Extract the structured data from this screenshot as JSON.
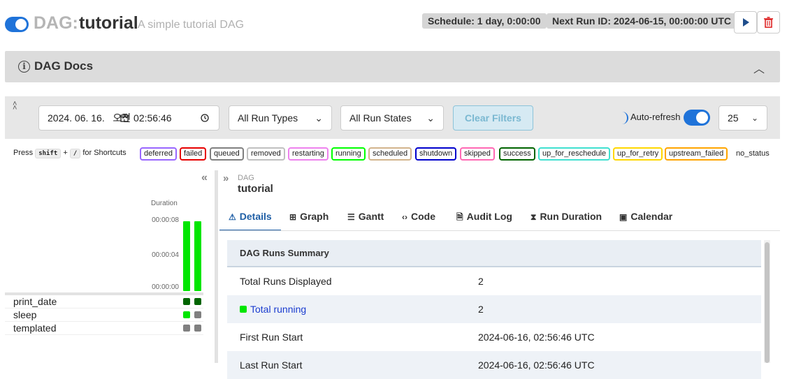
{
  "header": {
    "title_prefix": "DAG:",
    "dag_id": "tutorial",
    "description": "A simple tutorial DAG",
    "schedule": "Schedule: 1 day, 0:00:00",
    "next_run": "Next Run ID: 2024-06-15, 00:00:00 UTC"
  },
  "docs": {
    "label": "DAG Docs"
  },
  "filters": {
    "datetime": "2024. 06. 16.   오전 02:56:46",
    "run_type": "All Run Types",
    "run_state": "All Run States",
    "clear_label": "Clear Filters",
    "auto_refresh_label": "Auto-refresh",
    "page_size": "25"
  },
  "shortcuts": {
    "press": "Press",
    "key1": "shift",
    "plus": "+",
    "key2": "/",
    "suffix": "for Shortcuts"
  },
  "states": [
    {
      "label": "deferred",
      "color": "#9966ff"
    },
    {
      "label": "failed",
      "color": "#e60000"
    },
    {
      "label": "queued",
      "color": "#808080"
    },
    {
      "label": "removed",
      "color": "#c0c0c0"
    },
    {
      "label": "restarting",
      "color": "#ee82ee"
    },
    {
      "label": "running",
      "color": "#00ff00"
    },
    {
      "label": "scheduled",
      "color": "#d2b48c"
    },
    {
      "label": "shutdown",
      "color": "#0000cc"
    },
    {
      "label": "skipped",
      "color": "#ff69b4"
    },
    {
      "label": "success",
      "color": "#006400"
    },
    {
      "label": "up_for_reschedule",
      "color": "#40e0d0"
    },
    {
      "label": "up_for_retry",
      "color": "#ffd700"
    },
    {
      "label": "upstream_failed",
      "color": "#ffa500"
    },
    {
      "label": "no_status",
      "color": ""
    }
  ],
  "grid": {
    "duration_label": "Duration",
    "ticks": [
      "00:00:08",
      "00:00:04",
      "00:00:00"
    ],
    "run_bar_fill": [
      1.0,
      1.0
    ],
    "tasks": [
      {
        "name": "print_date",
        "states": [
          "success",
          "success"
        ]
      },
      {
        "name": "sleep",
        "states": [
          "running",
          "queued"
        ]
      },
      {
        "name": "templated",
        "states": [
          "queued",
          "queued"
        ]
      }
    ]
  },
  "breadcrumb": {
    "small": "DAG",
    "big": "tutorial"
  },
  "tabs": [
    {
      "label": "Details",
      "icon": "warning-icon",
      "glyph": "⚠"
    },
    {
      "label": "Graph",
      "icon": "graph-icon",
      "glyph": "⊞"
    },
    {
      "label": "Gantt",
      "icon": "gantt-icon",
      "glyph": "☰"
    },
    {
      "label": "Code",
      "icon": "code-icon",
      "glyph": "‹›"
    },
    {
      "label": "Audit Log",
      "icon": "audit-log-icon",
      "glyph": "🗎"
    },
    {
      "label": "Run Duration",
      "icon": "hourglass-icon",
      "glyph": "⧗"
    },
    {
      "label": "Calendar",
      "icon": "calendar-icon",
      "glyph": "▣"
    }
  ],
  "summary": {
    "title": "DAG Runs Summary",
    "rows": [
      {
        "key": "Total Runs Displayed",
        "value": "2"
      },
      {
        "key": "Total running",
        "value": "2"
      },
      {
        "key": "First Run Start",
        "value": "2024-06-16, 02:56:46 UTC"
      },
      {
        "key": "Last Run Start",
        "value": "2024-06-16, 02:56:46 UTC"
      }
    ]
  }
}
